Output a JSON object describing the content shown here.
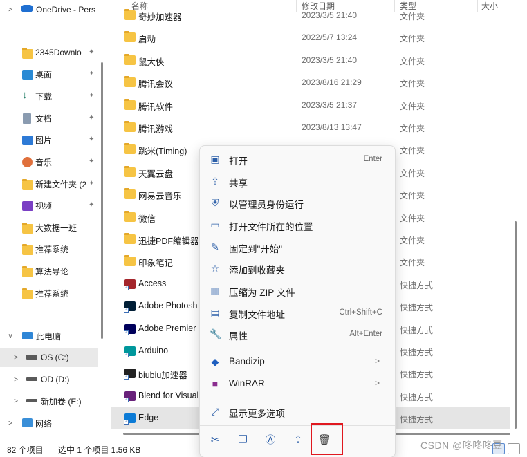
{
  "nav": {
    "items": [
      {
        "label": "OneDrive - Pers",
        "icon": "cloud-icon",
        "pinned": false
      },
      {
        "label": "2345Downlo",
        "icon": "folder-icon",
        "pinned": true
      },
      {
        "label": "桌面",
        "icon": "desktop-icon",
        "pinned": true
      },
      {
        "label": "下载",
        "icon": "download-icon",
        "pinned": true
      },
      {
        "label": "文档",
        "icon": "document-icon",
        "pinned": true
      },
      {
        "label": "图片",
        "icon": "picture-icon",
        "pinned": true
      },
      {
        "label": "音乐",
        "icon": "music-icon",
        "pinned": true
      },
      {
        "label": "新建文件夹 (2",
        "icon": "folder-icon",
        "pinned": true
      },
      {
        "label": "视频",
        "icon": "video-icon",
        "pinned": true
      },
      {
        "label": "大数据一班",
        "icon": "folder-icon",
        "pinned": false
      },
      {
        "label": "推荐系统",
        "icon": "folder-icon",
        "pinned": false
      },
      {
        "label": "算法导论",
        "icon": "folder-icon",
        "pinned": false
      },
      {
        "label": "推荐系统",
        "icon": "folder-icon",
        "pinned": false
      },
      {
        "label": "此电脑",
        "icon": "computer-icon",
        "pinned": false
      },
      {
        "label": "OS (C:)",
        "icon": "drive-icon",
        "pinned": false
      },
      {
        "label": "OD (D:)",
        "icon": "drive-icon",
        "pinned": false
      },
      {
        "label": "新加卷 (E:)",
        "icon": "drive-icon",
        "pinned": false
      },
      {
        "label": "网络",
        "icon": "network-icon",
        "pinned": false
      }
    ]
  },
  "columns": {
    "name": "名称",
    "date": "修改日期",
    "type": "类型",
    "size": "大小"
  },
  "files": [
    {
      "name": "奇妙加速器",
      "date": "2023/3/5 21:40",
      "type": "文件夹",
      "kind": "folder"
    },
    {
      "name": "启动",
      "date": "2022/5/7 13:24",
      "type": "文件夹",
      "kind": "folder"
    },
    {
      "name": "鼠大侠",
      "date": "2023/3/5 21:40",
      "type": "文件夹",
      "kind": "folder"
    },
    {
      "name": "腾讯会议",
      "date": "2023/8/16 21:29",
      "type": "文件夹",
      "kind": "folder"
    },
    {
      "name": "腾讯软件",
      "date": "2023/3/5 21:37",
      "type": "文件夹",
      "kind": "folder"
    },
    {
      "name": "腾讯游戏",
      "date": "2023/8/13 13:47",
      "type": "文件夹",
      "kind": "folder"
    },
    {
      "name": "跳米(Timing)",
      "date": "",
      "type": "文件夹",
      "kind": "folder"
    },
    {
      "name": "天翼云盘",
      "date": "",
      "type": "文件夹",
      "kind": "folder"
    },
    {
      "name": "网易云音乐",
      "date": "",
      "type": "文件夹",
      "kind": "folder"
    },
    {
      "name": "微信",
      "date": "",
      "type": "文件夹",
      "kind": "folder"
    },
    {
      "name": "迅捷PDF编辑器",
      "date": "",
      "type": "文件夹",
      "kind": "folder"
    },
    {
      "name": "印象笔记",
      "date": "",
      "type": "文件夹",
      "kind": "folder"
    },
    {
      "name": "Access",
      "date": "",
      "type": "快捷方式",
      "kind": "shortcut",
      "color": "#a4262c"
    },
    {
      "name": "Adobe Photosh",
      "date": "",
      "type": "快捷方式",
      "kind": "shortcut",
      "color": "#001e36"
    },
    {
      "name": "Adobe Premier",
      "date": "",
      "type": "快捷方式",
      "kind": "shortcut",
      "color": "#00005b"
    },
    {
      "name": "Arduino",
      "date": "",
      "type": "快捷方式",
      "kind": "shortcut",
      "color": "#00979c"
    },
    {
      "name": "biubiu加速器",
      "date": "",
      "type": "快捷方式",
      "kind": "shortcut",
      "color": "#222222"
    },
    {
      "name": "Blend for Visual",
      "date": "",
      "type": "快捷方式",
      "kind": "shortcut",
      "color": "#68217a"
    },
    {
      "name": "Edge",
      "date": "",
      "type": "快捷方式",
      "kind": "shortcut",
      "color": "#0c7bd6"
    }
  ],
  "context_menu": {
    "items": [
      {
        "label": "打开",
        "shortcut": "Enter",
        "icon": "open-icon"
      },
      {
        "label": "共享",
        "shortcut": "",
        "icon": "share-icon"
      },
      {
        "label": "以管理员身份运行",
        "shortcut": "",
        "icon": "shield-icon"
      },
      {
        "label": "打开文件所在的位置",
        "shortcut": "",
        "icon": "folder-open-icon"
      },
      {
        "label": "固定到\"开始\"",
        "shortcut": "",
        "icon": "pin-icon"
      },
      {
        "label": "添加到收藏夹",
        "shortcut": "",
        "icon": "star-icon"
      },
      {
        "label": "压缩为 ZIP 文件",
        "shortcut": "",
        "icon": "zip-icon"
      },
      {
        "label": "复制文件地址",
        "shortcut": "Ctrl+Shift+C",
        "icon": "copy-path-icon"
      },
      {
        "label": "属性",
        "shortcut": "Alt+Enter",
        "icon": "wrench-icon"
      }
    ],
    "submenus": [
      {
        "label": "Bandizip",
        "icon": "bandizip-icon"
      },
      {
        "label": "WinRAR",
        "icon": "winrar-icon"
      }
    ],
    "more": {
      "label": "显示更多选项",
      "icon": "more-options-icon"
    },
    "quick_actions": [
      "cut-icon",
      "copy-icon",
      "rename-icon",
      "share-icon",
      "delete-icon"
    ]
  },
  "status": {
    "count": "82 个项目",
    "selection": "选中 1 个项目  1.56 KB"
  },
  "watermark": "CSDN @咚咚咚豆",
  "colors": {
    "accent": "#2b5ea8",
    "highlight": "#e0181f",
    "folder": "#f6c444"
  }
}
